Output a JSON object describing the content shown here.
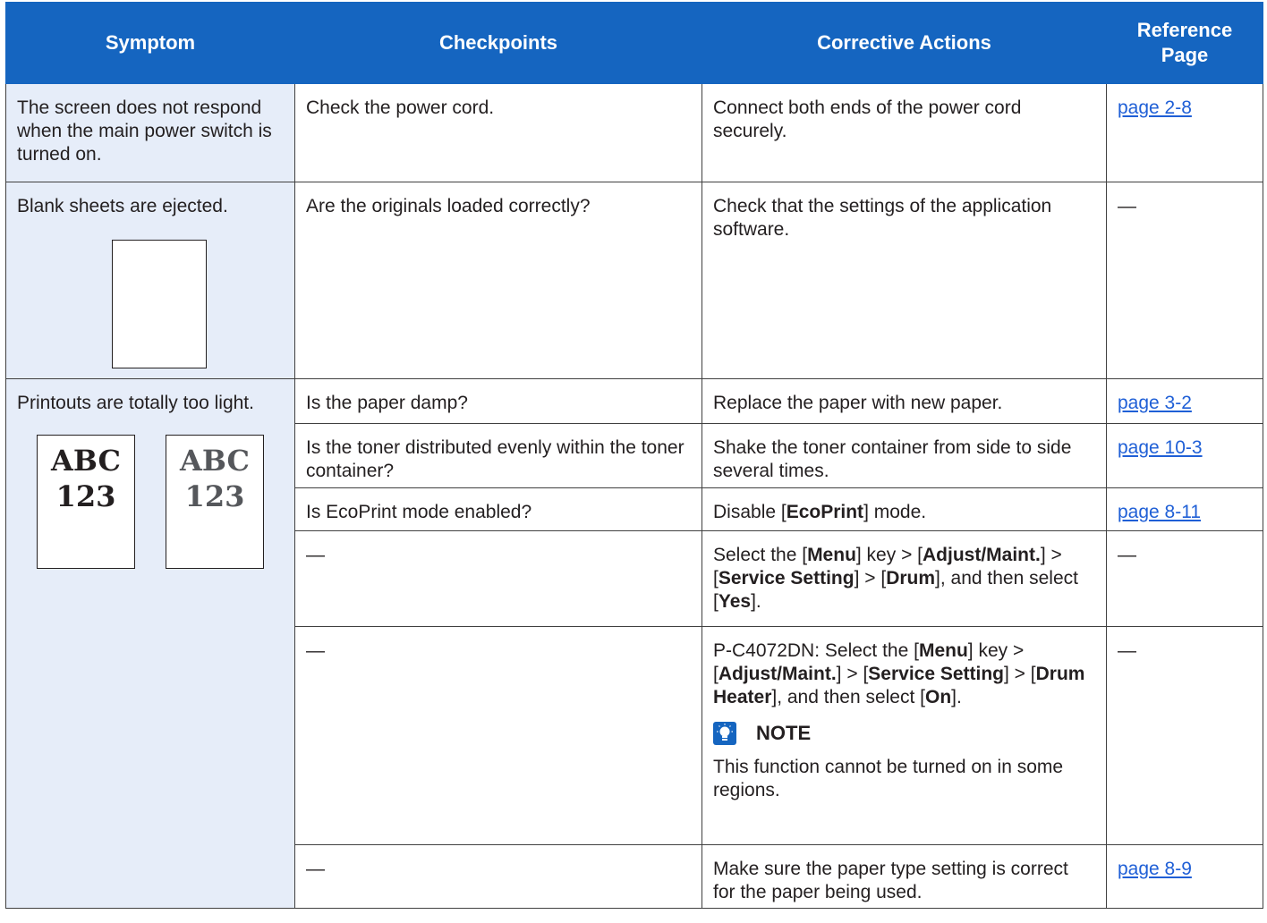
{
  "headers": {
    "symptom": "Symptom",
    "checkpoints": "Checkpoints",
    "corrective": "Corrective Actions",
    "reference": "Reference Page"
  },
  "rows": [
    {
      "symptom": "The screen does not respond when the main power switch is turned on.",
      "checkpoint": "Check the power cord.",
      "action": "Connect both ends of the power cord securely.",
      "reference": "page 2-8"
    },
    {
      "symptom": "Blank sheets are ejected.",
      "checkpoint": "Are the originals loaded correctly?",
      "action": "Check that the settings of the application software.",
      "reference": "—"
    }
  ],
  "light": {
    "symptom": "Printouts are totally too light.",
    "sample_line1": "ABC",
    "sample_line2": "123",
    "sub": [
      {
        "checkpoint": "Is the paper damp?",
        "action": "Replace the paper with new paper.",
        "reference": "page 3-2"
      },
      {
        "checkpoint": "Is the toner distributed evenly within the toner container?",
        "action": "Shake the toner container from side to side several times.",
        "reference": "page 10-3"
      },
      {
        "checkpoint": "Is EcoPrint mode enabled?",
        "action_pre": "Disable [",
        "action_bold": "EcoPrint",
        "action_post": "] mode.",
        "reference": "page 8-11"
      },
      {
        "checkpoint": "—",
        "reference": "—",
        "a1": "Select the [",
        "b1": "Menu",
        "a2": "] key > [",
        "b2": "Adjust/Maint.",
        "a3": "] > [",
        "b3": "Service Setting",
        "a4": "] > [",
        "b4": "Drum",
        "a5": "], and then select [",
        "b5": "Yes",
        "a6": "]."
      },
      {
        "checkpoint": "—",
        "reference": "—",
        "a1": "P-C4072DN: Select the [",
        "b1": "Menu",
        "a2": "] key > [",
        "b2": "Adjust/Maint.",
        "a3": "] > [",
        "b3": "Service Setting",
        "a4": "] > [",
        "b4": "Drum Heater",
        "a5": "], and then select [",
        "b5": "On",
        "a6": "].",
        "note_label": "NOTE",
        "note_text": "This function cannot be turned on in some regions."
      },
      {
        "checkpoint": "—",
        "action": "Make sure the paper type setting is correct for the paper being used.",
        "reference": "page 8-9"
      }
    ]
  },
  "colors": {
    "header_bg": "#1565c0",
    "symptom_bg": "#e6edf9",
    "link": "#1f5fd6"
  }
}
